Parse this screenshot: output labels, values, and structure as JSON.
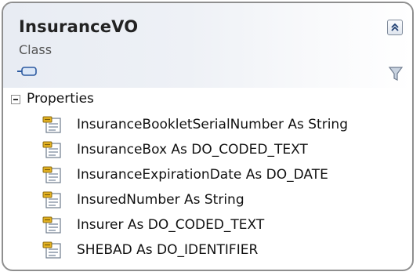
{
  "class": {
    "name": "InsuranceVO",
    "stereotype": "Class"
  },
  "compartment": {
    "title": "Properties",
    "members": [
      {
        "text": "InsuranceBookletSerialNumber As String"
      },
      {
        "text": "InsuranceBox As DO_CODED_TEXT"
      },
      {
        "text": "InsuranceExpirationDate As DO_DATE"
      },
      {
        "text": "InsuredNumber As String"
      },
      {
        "text": "Insurer As DO_CODED_TEXT"
      },
      {
        "text": "SHEBAD As DO_IDENTIFIER"
      }
    ]
  },
  "icons": {
    "collapse": "double-chevron-up-icon",
    "filter": "filter-icon",
    "class_glyph": "class-shape-icon",
    "property": "property-icon",
    "expander": "minus-box-icon"
  },
  "colors": {
    "border": "#8f8f8f",
    "header_gradient_start": "#e8ecf3",
    "property_icon_accent": "#d4a017"
  }
}
